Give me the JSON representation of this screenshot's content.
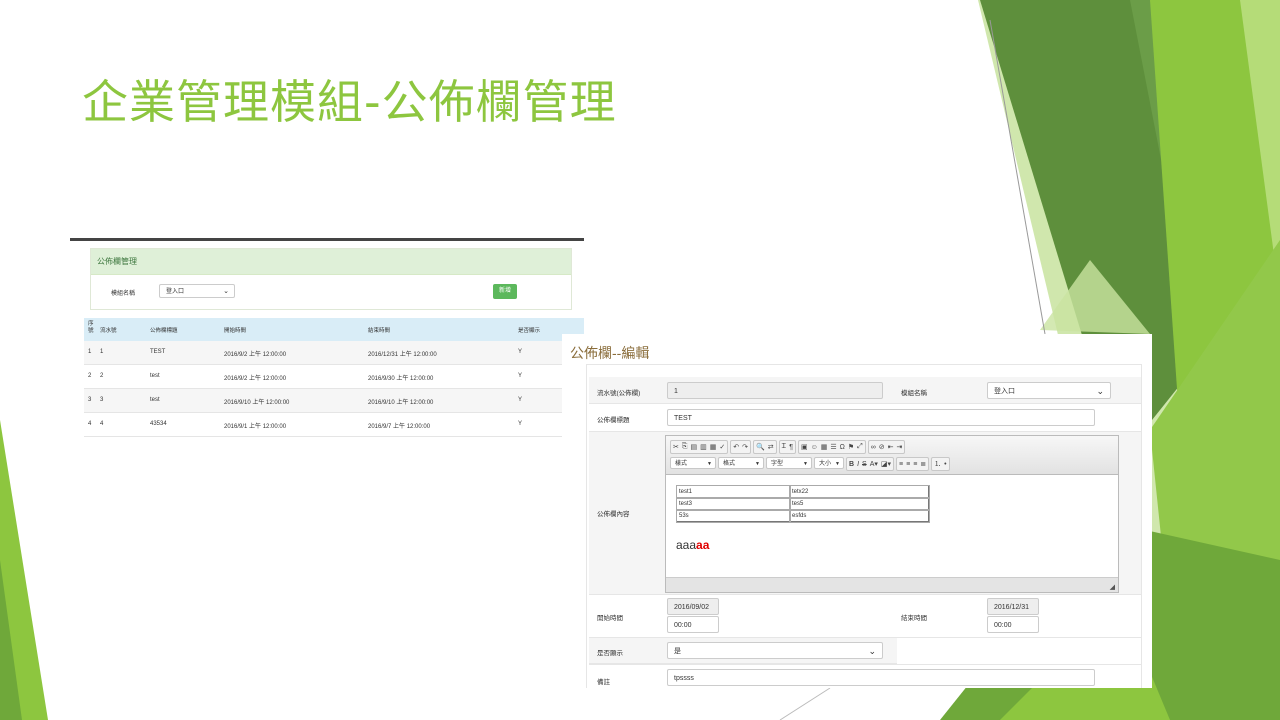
{
  "slide": {
    "title": "企業管理模組-公佈欄管理"
  },
  "colors": {
    "accent_green": "#8dc63f",
    "panel_green": "#dff0d8",
    "table_head_blue": "#d9edf7",
    "button_green": "#5cb85c"
  },
  "list": {
    "panel_title": "公佈欄管理",
    "module_label": "模組名稱",
    "module_value": "登入口",
    "add_button": "新增",
    "columns": [
      "序號",
      "流水號",
      "公佈欄標題",
      "開始時間",
      "結束時間",
      "是否顯示"
    ],
    "rows": [
      [
        "1",
        "1",
        "TEST",
        "2016/9/2 上午 12:00:00",
        "2016/12/31 上午 12:00:00",
        "Y"
      ],
      [
        "2",
        "2",
        "test",
        "2016/9/2 上午 12:00:00",
        "2016/9/30 上午 12:00:00",
        "Y"
      ],
      [
        "3",
        "3",
        "test",
        "2016/9/10 上午 12:00:00",
        "2016/9/10 上午 12:00:00",
        "Y"
      ],
      [
        "4",
        "4",
        "43534",
        "2016/9/1 上午 12:00:00",
        "2016/9/7 上午 12:00:00",
        "Y"
      ]
    ]
  },
  "edit": {
    "title": "公佈欄--編輯",
    "serial_label": "流水號(公佈欄)",
    "serial_value": "1",
    "module_label": "模組名稱",
    "module_value": "登入口",
    "bulletin_title_label": "公佈欄標題",
    "bulletin_title_value": "TEST",
    "content_label": "公佈欄內容",
    "editor": {
      "style_combo": "樣式",
      "format_combo": "格式",
      "font_combo": "字型",
      "size_combo": "大小",
      "table": [
        [
          "test1",
          "tetx22"
        ],
        [
          "test3",
          "tes5"
        ],
        [
          "53s",
          "esfds"
        ]
      ],
      "text_plain": "aaa",
      "text_red": "aa"
    },
    "start_label": "開始時間",
    "start_date": "2016/09/02",
    "start_time": "00:00",
    "end_label": "結束時間",
    "end_date": "2016/12/31",
    "end_time": "00:00",
    "visible_label": "是否顯示",
    "visible_value": "是",
    "remark_label": "備註",
    "remark_value": "tpssss"
  }
}
